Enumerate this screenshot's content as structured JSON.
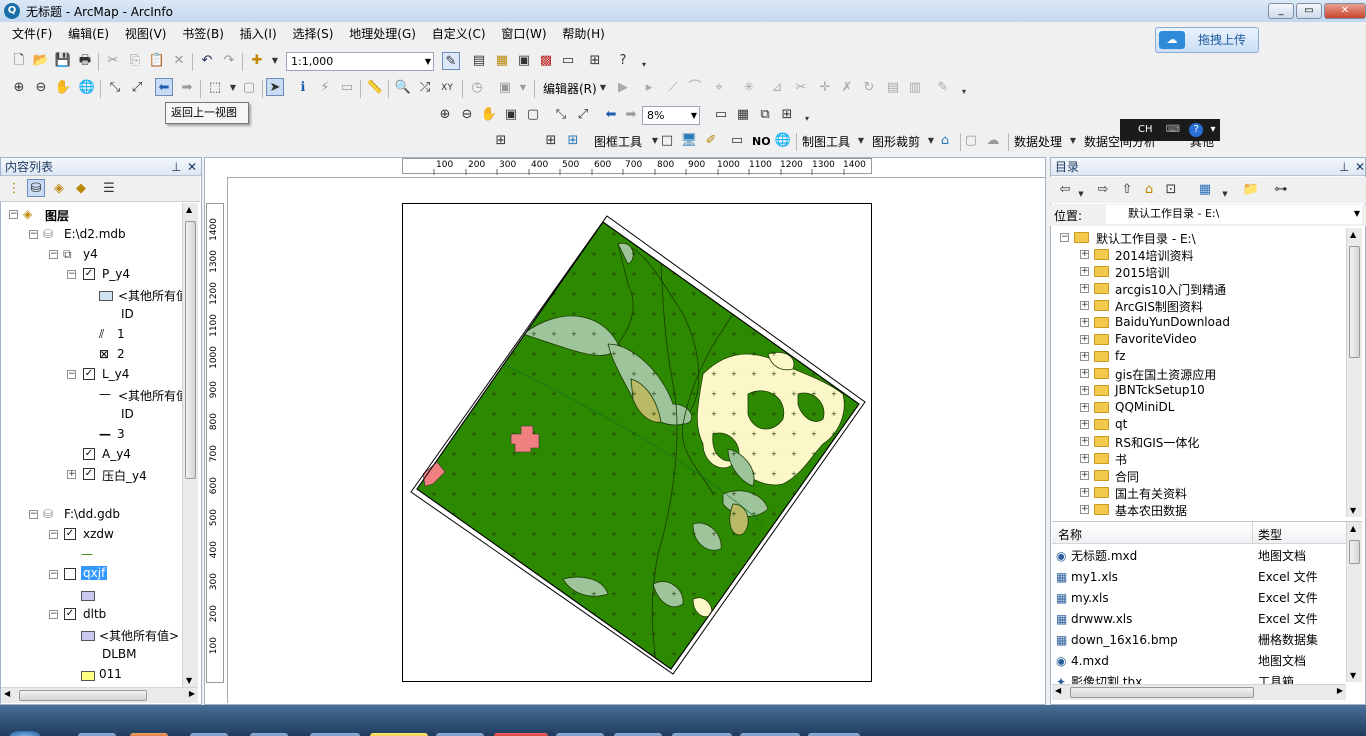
{
  "window": {
    "title": "无标题 - ArcMap - ArcInfo",
    "min": "_",
    "max": "▭",
    "close": "✕"
  },
  "menu": [
    "文件(F)",
    "编辑(E)",
    "视图(V)",
    "书签(B)",
    "插入(I)",
    "选择(S)",
    "地理处理(G)",
    "自定义(C)",
    "窗口(W)",
    "帮助(H)"
  ],
  "toolbar": {
    "scale": "1:1,000",
    "editor": "编辑器(R)",
    "zoom_pct": "8%",
    "tooltip": "返回上一视图",
    "frame_tools": "图框工具",
    "no_label": "NO",
    "cartography": "制图工具",
    "clip": "图形裁剪",
    "geoprocessing": "数据处理",
    "spatial": "数据空间分析",
    "other": "其他"
  },
  "upload": {
    "label": "拖拽上传"
  },
  "ime": {
    "lang": "CH"
  },
  "toc": {
    "title": "内容列表",
    "root": "图层",
    "db1": "E:\\d2.mdb",
    "y4": "y4",
    "p_y4": "P_y4",
    "other_values": "<其他所有值>",
    "id": "ID",
    "v1": "1",
    "v2": "2",
    "l_y4": "L_y4",
    "other_values2": "<其他所有值>",
    "id2": "ID",
    "v3": "3",
    "a_y4": "A_y4",
    "yabai": "压白_y4",
    "db2": "F:\\dd.gdb",
    "xzdw": "xzdw",
    "qxjf": "qxjf",
    "dltb": "dltb",
    "other_values3": "<其他所有值>",
    "dlbm": "DLBM",
    "v011": "011"
  },
  "ruler": {
    "h_ticks": [
      "100",
      "200",
      "300",
      "400",
      "500",
      "600",
      "700",
      "800",
      "900",
      "1000",
      "1100",
      "1200",
      "1300",
      "1400"
    ],
    "v_ticks": [
      "1400",
      "1300",
      "1200",
      "1100",
      "1000",
      "900",
      "800",
      "700",
      "600",
      "500",
      "400",
      "300",
      "200",
      "100"
    ]
  },
  "catalog": {
    "title": "目录",
    "location_label": "位置:",
    "location_value": "默认工作目录 - E:\\",
    "root": "默认工作目录 - E:\\",
    "folders": [
      "2014培训资料",
      "2015培训",
      "arcgis10入门到精通",
      "ArcGIS制图资料",
      "BaiduYunDownload",
      "FavoriteVideo",
      "fz",
      "gis在国土资源应用",
      "JBNTckSetup10",
      "QQMiniDL",
      "qt",
      "RS和GIS一体化",
      "书",
      "合同",
      "国土有关资料",
      "基本农田数据"
    ],
    "col_name": "名称",
    "col_type": "类型",
    "files": [
      {
        "name": "无标题.mxd",
        "type": "地图文档"
      },
      {
        "name": "my1.xls",
        "type": "Excel 文件"
      },
      {
        "name": "my.xls",
        "type": "Excel 文件"
      },
      {
        "name": "drwww.xls",
        "type": "Excel 文件"
      },
      {
        "name": "down_16x16.bmp",
        "type": "栅格数据集"
      },
      {
        "name": "4.mxd",
        "type": "地图文档"
      },
      {
        "name": "影像切割.tbx",
        "type": "工具箱"
      }
    ]
  },
  "colors": {
    "green": "#2d8a00",
    "light_green": "#9dc49a",
    "cream": "#fbf7c8",
    "khaki": "#b9b966",
    "pink": "#f08080",
    "selection": "#3399ff"
  }
}
